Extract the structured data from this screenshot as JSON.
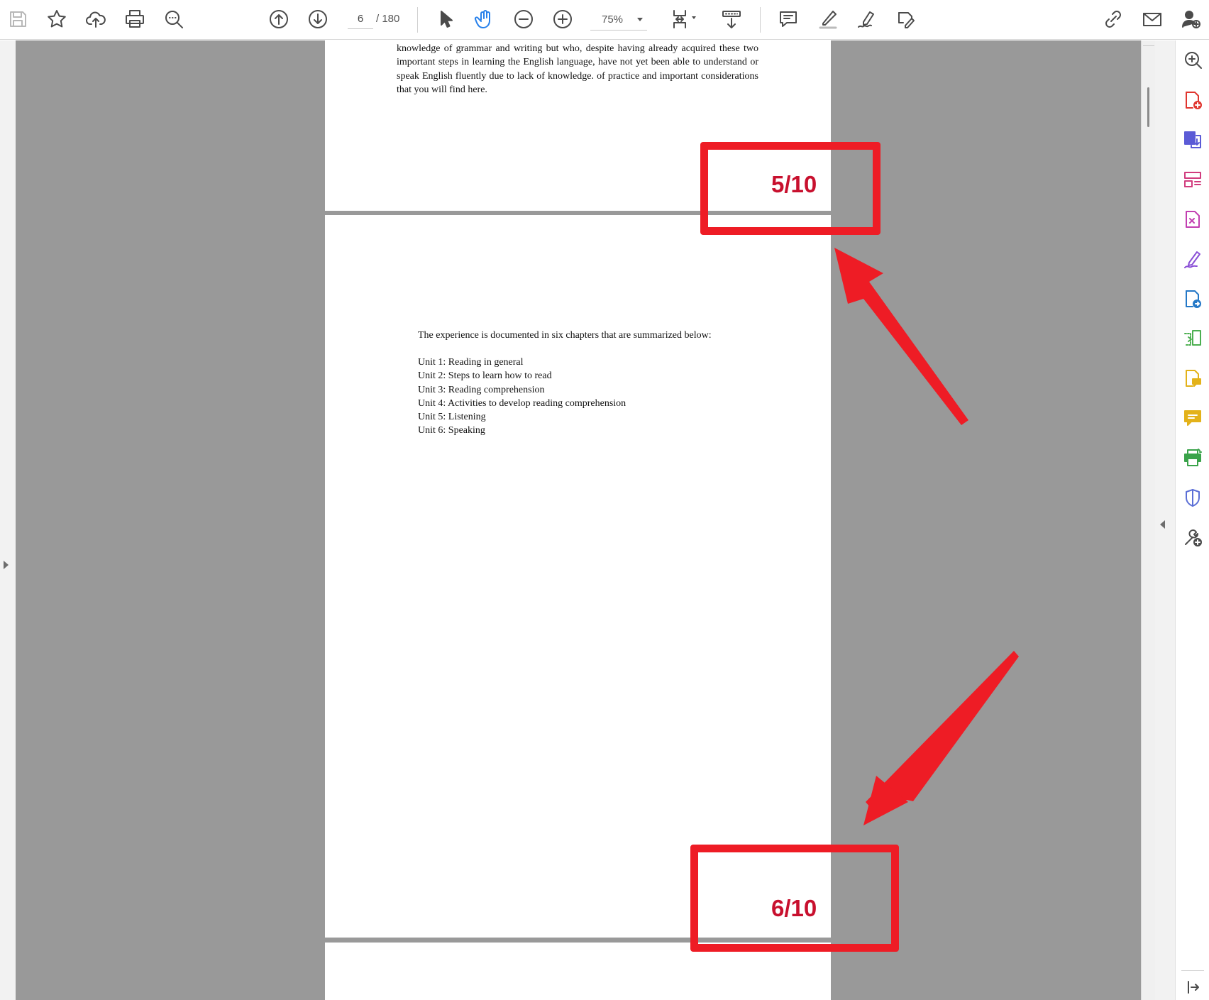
{
  "toolbar": {
    "page_number": "6",
    "page_total": "/ 180",
    "zoom": "75%"
  },
  "document": {
    "page5": {
      "text": "knowledge of grammar and writing but who, despite having already acquired these two important steps in learning the English language, have not yet been able to understand or speak English fluently due to lack of knowledge. of practice and important considerations that you will find here.",
      "page_label": "5/10"
    },
    "page6": {
      "intro": "The experience is documented in six chapters that are summarized below:",
      "units": [
        "Unit 1: Reading in general",
        "Unit 2: Steps to learn how to read",
        "Unit 3: Reading comprehension",
        "Unit 4: Activities to develop reading comprehension",
        "Unit 5: Listening",
        "Unit 6: Speaking"
      ],
      "page_label": "6/10"
    }
  },
  "annotation": {
    "color": "#ee1c25",
    "label_color": "#c8102e"
  },
  "icons": {
    "toolbar": [
      "save-icon",
      "bookmark-star-icon",
      "upload-cloud-icon",
      "print-icon",
      "search-zoom-icon",
      "page-up-icon",
      "page-down-icon",
      "cursor-select-icon",
      "hand-tool-icon",
      "zoom-out-icon",
      "zoom-in-icon",
      "page-fit-icon",
      "scroll-mode-icon",
      "comment-icon",
      "highlight-pen-icon",
      "draw-sign-icon",
      "edit-fill-icon",
      "share-link-icon",
      "email-icon",
      "add-user-icon"
    ],
    "tool_panel": [
      "search-icon",
      "create-pdf-icon",
      "export-pdf-icon",
      "organize-pages-icon",
      "edit-pdf-icon",
      "fill-sign-icon",
      "send-for-signature-icon",
      "combine-files-icon",
      "comment-tool-icon",
      "sticky-note-icon",
      "print-production-icon",
      "protect-shield-icon",
      "more-tools-icon",
      "collapse-panel-icon"
    ]
  }
}
